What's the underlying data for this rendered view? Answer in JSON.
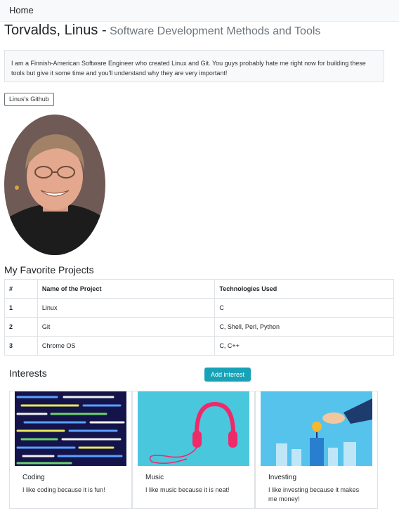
{
  "nav": {
    "home": "Home"
  },
  "header": {
    "name": "Torvalds, Linus -",
    "subtitle": "Software Development Methods and Tools"
  },
  "bio": "I am a Finnish-American Software Engineer who created Linux and Git. You guys probably hate me right now for building these tools but give it some time and you'll understand why they are very important!",
  "github_button": "Linus's Github",
  "projects": {
    "heading": "My Favorite Projects",
    "columns": [
      "#",
      "Name of the Project",
      "Technologies Used"
    ],
    "rows": [
      [
        "1",
        "Linux",
        "C"
      ],
      [
        "2",
        "Git",
        "C, Shell, Perl, Python"
      ],
      [
        "3",
        "Chrome OS",
        "C, C++"
      ]
    ]
  },
  "interests": {
    "heading": "Interests",
    "add_button": "Add interest",
    "cards": [
      {
        "title": "Coding",
        "text": "I like coding because it is fun!"
      },
      {
        "title": "Music",
        "text": "I like music because it is neat!"
      },
      {
        "title": "Investing",
        "text": "I like investing because it makes me money!"
      }
    ]
  },
  "colors": {
    "accent": "#17a2b8",
    "navbar": "#f8f9fa",
    "border": "#dee2e6"
  }
}
